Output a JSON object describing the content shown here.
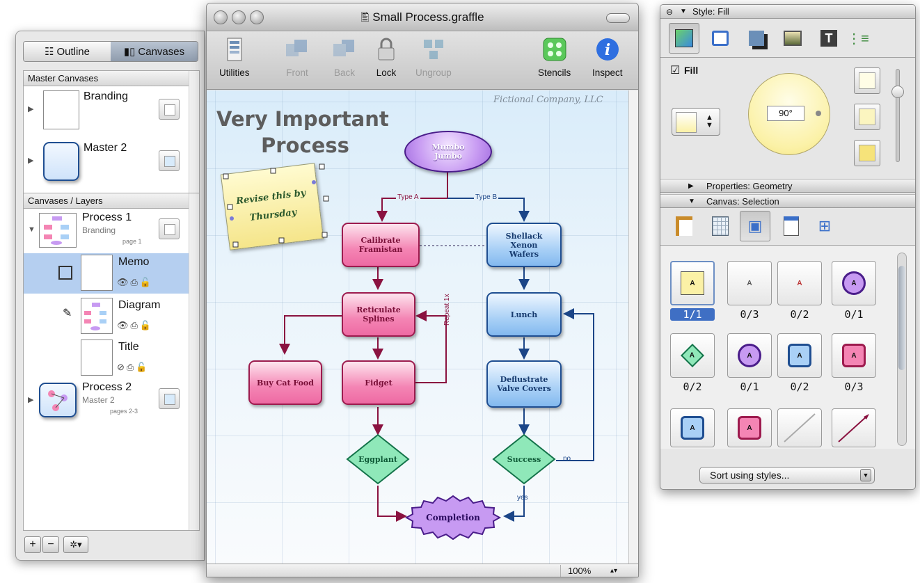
{
  "drawer": {
    "tabs": [
      {
        "label": "Outline"
      },
      {
        "label": "Canvases"
      }
    ],
    "master_header": "Master Canvases",
    "masters": [
      {
        "name": "Branding"
      },
      {
        "name": "Master  2"
      }
    ],
    "layers_header": "Canvases / Layers",
    "canvases": [
      {
        "name": "Process 1",
        "master": "Branding",
        "pages": "page 1"
      },
      {
        "name": "Process 2",
        "master": "Master  2",
        "pages": "pages 2-3"
      }
    ],
    "layers": [
      {
        "name": "Memo"
      },
      {
        "name": "Diagram"
      },
      {
        "name": "Title"
      }
    ],
    "footer": {
      "add": "+",
      "remove": "−",
      "gear": "✲▾"
    }
  },
  "window": {
    "title": "Small Process.graffle",
    "toolbar": [
      {
        "label": "Utilities",
        "icon": "utilities-icon"
      },
      {
        "label": "Front",
        "icon": "front-icon"
      },
      {
        "label": "Back",
        "icon": "back-icon"
      },
      {
        "label": "Lock",
        "icon": "lock-icon"
      },
      {
        "label": "Ungroup",
        "icon": "ungroup-icon"
      },
      {
        "label": "Stencils",
        "icon": "stencils-icon"
      },
      {
        "label": "Inspect",
        "icon": "inspect-icon"
      }
    ],
    "zoom": "100%"
  },
  "diagram": {
    "company": "Fictional Company, LLC",
    "title_line1": "Very Important",
    "title_line2": "Process",
    "memo_line1": "Revise this by",
    "memo_line2": "Thursday",
    "nodes": {
      "mumbo": "Mumbo Jumbo",
      "calibrate": "Calibrate Framistan",
      "shellack": "Shellack Xenon Wafers",
      "reticulate": "Reticulate Splines",
      "lunch": "Lunch",
      "catfood": "Buy Cat Food",
      "fidget": "Fidget",
      "deflustrate": "Deflustrate Valve Covers",
      "eggplant": "Eggplant",
      "success": "Success",
      "completion": "Completion"
    },
    "edges": {
      "type_a": "Type A",
      "type_b": "Type B",
      "repeat": "Repeat 1x",
      "no": "no",
      "yes": "yes"
    }
  },
  "inspector": {
    "style_header": "Style: Fill",
    "fill_label": "Fill",
    "fill_checked": "☑",
    "angle": "90°",
    "geometry_header": "Properties: Geometry",
    "selection_header": "Canvas: Selection",
    "counts": [
      "1/1",
      "0/3",
      "0/2",
      "0/1",
      "0/2",
      "0/1",
      "0/2",
      "0/3"
    ],
    "sort_label": "Sort using styles...",
    "colors": {
      "pink_node": "#f485b4",
      "blue_node": "#a9d0f6",
      "green_node": "#8fe8b9",
      "purple_node": "#c79af2",
      "fill_yellow": "#fbf1a6"
    }
  }
}
